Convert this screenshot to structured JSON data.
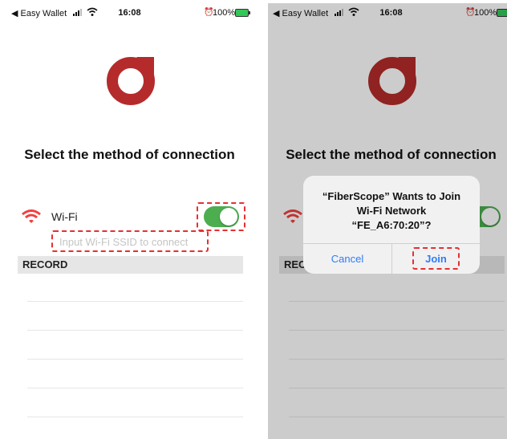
{
  "colors": {
    "brand": "#b52b2b",
    "toggle_on": "#4cae4f",
    "wifi_icon": "#f04040",
    "highlight": "#e53030",
    "link": "#2f7cf6"
  },
  "status_bar": {
    "back_label": "◀ Easy Wallet",
    "time": "16:08",
    "battery": "100%"
  },
  "page": {
    "heading": "Select the method of connection"
  },
  "wifi": {
    "label": "Wi-Fi",
    "enabled": true,
    "ssid_placeholder": "Input Wi-Fi SSID to connect",
    "ssid_value": ""
  },
  "record": {
    "header": "RECORD"
  },
  "dialog": {
    "line1": "“FiberScope” Wants to Join",
    "line2": "Wi-Fi Network",
    "line3": "“FE_A6:70:20”?",
    "cancel_label": "Cancel",
    "join_label": "Join"
  },
  "icons": {
    "back": "back-arrow-icon",
    "signal": "cellular-signal-icon",
    "wifi_status": "wifi-icon",
    "alarm": "alarm-icon",
    "battery": "battery-icon",
    "logo": "fiberscope-logo-icon",
    "wifi_option": "wifi-icon"
  }
}
